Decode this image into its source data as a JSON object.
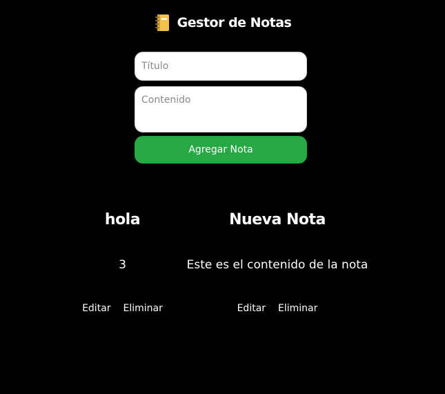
{
  "app": {
    "title": "Gestor de Notas",
    "icon": "notebook-icon"
  },
  "form": {
    "title_placeholder": "Título",
    "title_value": "",
    "content_placeholder": "Contenido",
    "content_value": "",
    "add_button_label": "Agregar Nota"
  },
  "notes": [
    {
      "title": "hola",
      "content": "3",
      "edit_label": "Editar",
      "delete_label": "Eliminar"
    },
    {
      "title": "Nueva Nota",
      "content": "Este es el contenido de la nota",
      "edit_label": "Editar",
      "delete_label": "Eliminar"
    }
  ],
  "colors": {
    "background": "#000000",
    "text": "#ffffff",
    "add_button": "#28a745",
    "input_background": "#ffffff",
    "icon_cover": "#f2c14e",
    "icon_rings": "#8a6d2f"
  }
}
